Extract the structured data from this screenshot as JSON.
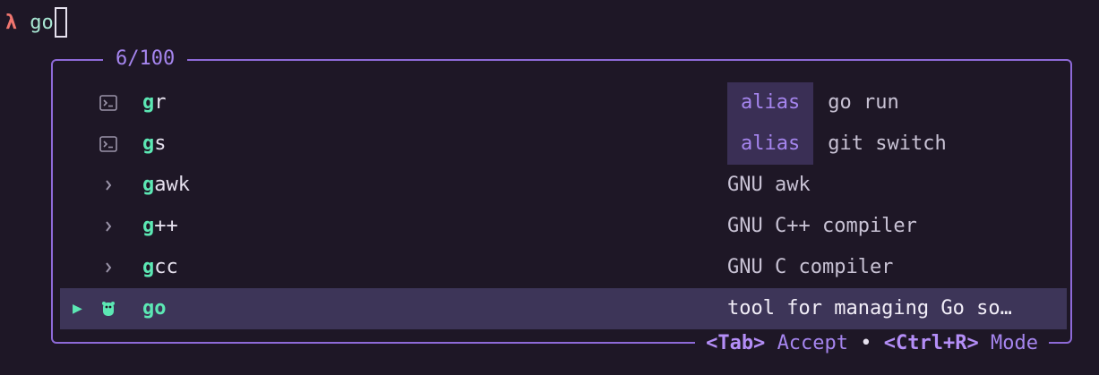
{
  "prompt": {
    "symbol": "λ",
    "typed": "go"
  },
  "panel": {
    "count": "6/100"
  },
  "items": [
    {
      "highlight": "g",
      "rest": "r",
      "icon": "terminal-icon",
      "badge": "alias",
      "detail": "go run"
    },
    {
      "highlight": "g",
      "rest": "s",
      "icon": "terminal-icon",
      "badge": "alias",
      "detail": "git switch"
    },
    {
      "highlight": "g",
      "rest": "awk",
      "icon": "chevron-right-icon",
      "detail": "GNU awk"
    },
    {
      "highlight": "g",
      "rest": "++",
      "icon": "chevron-right-icon",
      "detail": "GNU C++ compiler"
    },
    {
      "highlight": "g",
      "rest": "cc",
      "icon": "chevron-right-icon",
      "detail": "GNU C compiler"
    },
    {
      "highlight": "go",
      "rest": "",
      "icon": "gopher-icon",
      "selected": true,
      "pointer": "▶",
      "detail": "tool for managing Go so…"
    }
  ],
  "footer": {
    "accept_key": "<Tab>",
    "accept_label": "Accept",
    "separator": "•",
    "mode_key": "<Ctrl+R>",
    "mode_label": "Mode"
  },
  "colors": {
    "background": "#1e1726",
    "border": "#8e6ad8",
    "match": "#5ce8b4",
    "selected_row": "#3d3558",
    "badge_bg": "#3a2f55"
  }
}
